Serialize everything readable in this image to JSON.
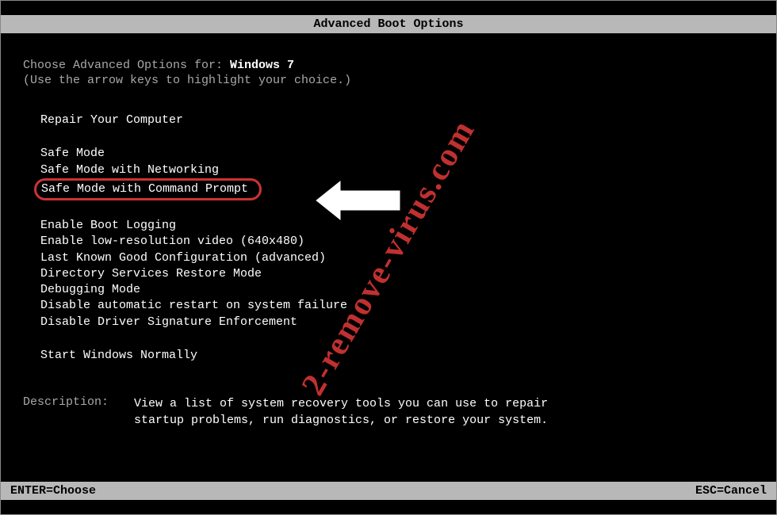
{
  "title": "Advanced Boot Options",
  "header": {
    "prefix": "Choose Advanced Options for: ",
    "os_name": "Windows 7",
    "hint": "(Use the arrow keys to highlight your choice.)"
  },
  "menu": {
    "group1": [
      "Repair Your Computer"
    ],
    "group2": [
      "Safe Mode",
      "Safe Mode with Networking",
      "Safe Mode with Command Prompt"
    ],
    "group3": [
      "Enable Boot Logging",
      "Enable low-resolution video (640x480)",
      "Last Known Good Configuration (advanced)",
      "Directory Services Restore Mode",
      "Debugging Mode",
      "Disable automatic restart on system failure",
      "Disable Driver Signature Enforcement"
    ],
    "group4": [
      "Start Windows Normally"
    ]
  },
  "description": {
    "label": "Description:",
    "text_line1": "View a list of system recovery tools you can use to repair",
    "text_line2": "startup problems, run diagnostics, or restore your system."
  },
  "footer": {
    "left": "ENTER=Choose",
    "right": "ESC=Cancel"
  },
  "watermark": "2-remove-virus.com"
}
